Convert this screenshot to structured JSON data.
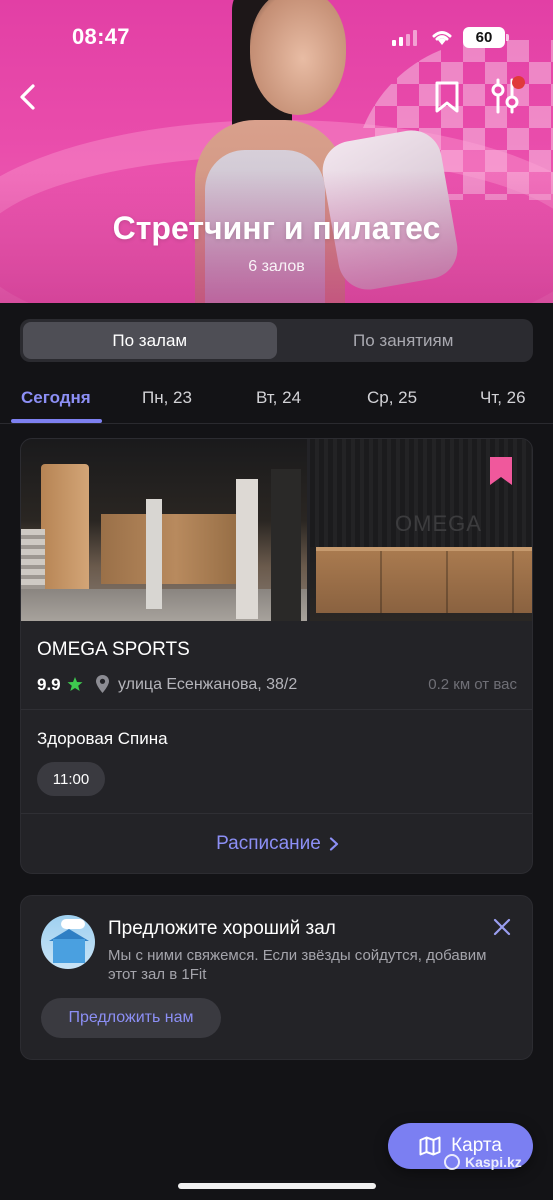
{
  "status_bar": {
    "time": "08:47",
    "battery": "60"
  },
  "hero": {
    "title": "Стретчинг и пилатес",
    "subtitle": "6 залов"
  },
  "segmented": {
    "tabs": [
      {
        "label": "По залам",
        "active": true
      },
      {
        "label": "По занятиям",
        "active": false
      }
    ]
  },
  "days": [
    {
      "label": "Сегодня",
      "active": true
    },
    {
      "label": "Пн, 23"
    },
    {
      "label": "Вт, 24"
    },
    {
      "label": "Ср, 25"
    },
    {
      "label": "Чт, 26"
    }
  ],
  "gym": {
    "photo_logo_text": "OMEGA",
    "name": "OMEGA SPORTS",
    "rating": "9.9",
    "address": "улица Есенжанова, 38/2",
    "distance": "0.2 км от вас",
    "class_name": "Здоровая Спина",
    "time_slot": "11:00",
    "schedule_label": "Расписание"
  },
  "suggest": {
    "title": "Предложите хороший зал",
    "text": "Мы с ними свяжемся. Если звёзды сойдутся, добавим этот зал в 1Fit",
    "button_label": "Предложить нам"
  },
  "map_button": {
    "label": "Карта"
  },
  "watermark": "Kaspi.kz",
  "colors": {
    "accent": "#7b7ff2",
    "bookmark_pink": "#f0589c",
    "rating_star": "#3ec94f",
    "background": "#131316",
    "card": "#232327"
  }
}
